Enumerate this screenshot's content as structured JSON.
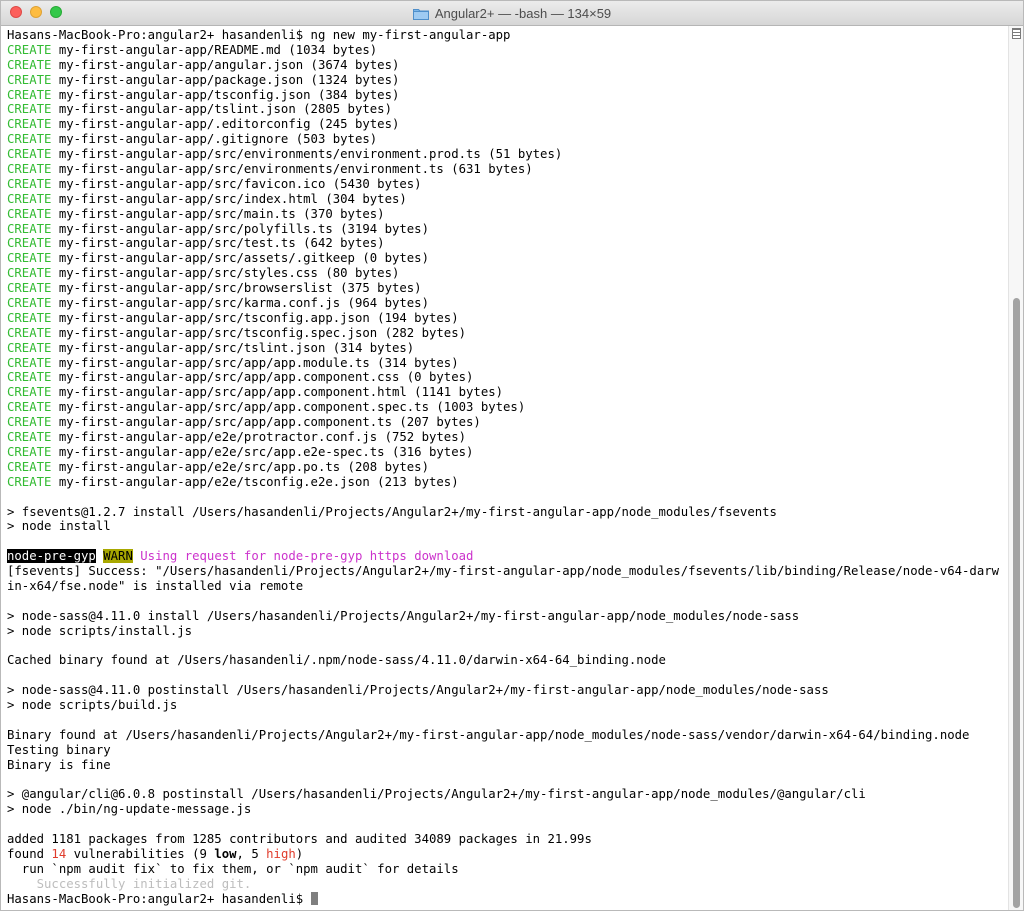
{
  "window": {
    "title": "Angular2+ — -bash — 134×59"
  },
  "icons": {
    "title": "folder-icon",
    "close": "close-button",
    "minimize": "minimize-button",
    "maximize": "zoom-button",
    "split": "split-pane-icon"
  },
  "colors": {
    "create": "#33bb33",
    "warn_message": "#cc33cc",
    "high_count": "#e03c2c"
  },
  "terminal": {
    "lines": [
      [
        {
          "t": "Hasans-MacBook-Pro:angular2+ hasandenli$ ng new my-first-angular-app"
        }
      ],
      [
        {
          "t": "CREATE",
          "c": "green"
        },
        {
          "t": " my-first-angular-app/README.md (1034 bytes)"
        }
      ],
      [
        {
          "t": "CREATE",
          "c": "green"
        },
        {
          "t": " my-first-angular-app/angular.json (3674 bytes)"
        }
      ],
      [
        {
          "t": "CREATE",
          "c": "green"
        },
        {
          "t": " my-first-angular-app/package.json (1324 bytes)"
        }
      ],
      [
        {
          "t": "CREATE",
          "c": "green"
        },
        {
          "t": " my-first-angular-app/tsconfig.json (384 bytes)"
        }
      ],
      [
        {
          "t": "CREATE",
          "c": "green"
        },
        {
          "t": " my-first-angular-app/tslint.json (2805 bytes)"
        }
      ],
      [
        {
          "t": "CREATE",
          "c": "green"
        },
        {
          "t": " my-first-angular-app/.editorconfig (245 bytes)"
        }
      ],
      [
        {
          "t": "CREATE",
          "c": "green"
        },
        {
          "t": " my-first-angular-app/.gitignore (503 bytes)"
        }
      ],
      [
        {
          "t": "CREATE",
          "c": "green"
        },
        {
          "t": " my-first-angular-app/src/environments/environment.prod.ts (51 bytes)"
        }
      ],
      [
        {
          "t": "CREATE",
          "c": "green"
        },
        {
          "t": " my-first-angular-app/src/environments/environment.ts (631 bytes)"
        }
      ],
      [
        {
          "t": "CREATE",
          "c": "green"
        },
        {
          "t": " my-first-angular-app/src/favicon.ico (5430 bytes)"
        }
      ],
      [
        {
          "t": "CREATE",
          "c": "green"
        },
        {
          "t": " my-first-angular-app/src/index.html (304 bytes)"
        }
      ],
      [
        {
          "t": "CREATE",
          "c": "green"
        },
        {
          "t": " my-first-angular-app/src/main.ts (370 bytes)"
        }
      ],
      [
        {
          "t": "CREATE",
          "c": "green"
        },
        {
          "t": " my-first-angular-app/src/polyfills.ts (3194 bytes)"
        }
      ],
      [
        {
          "t": "CREATE",
          "c": "green"
        },
        {
          "t": " my-first-angular-app/src/test.ts (642 bytes)"
        }
      ],
      [
        {
          "t": "CREATE",
          "c": "green"
        },
        {
          "t": " my-first-angular-app/src/assets/.gitkeep (0 bytes)"
        }
      ],
      [
        {
          "t": "CREATE",
          "c": "green"
        },
        {
          "t": " my-first-angular-app/src/styles.css (80 bytes)"
        }
      ],
      [
        {
          "t": "CREATE",
          "c": "green"
        },
        {
          "t": " my-first-angular-app/src/browserslist (375 bytes)"
        }
      ],
      [
        {
          "t": "CREATE",
          "c": "green"
        },
        {
          "t": " my-first-angular-app/src/karma.conf.js (964 bytes)"
        }
      ],
      [
        {
          "t": "CREATE",
          "c": "green"
        },
        {
          "t": " my-first-angular-app/src/tsconfig.app.json (194 bytes)"
        }
      ],
      [
        {
          "t": "CREATE",
          "c": "green"
        },
        {
          "t": " my-first-angular-app/src/tsconfig.spec.json (282 bytes)"
        }
      ],
      [
        {
          "t": "CREATE",
          "c": "green"
        },
        {
          "t": " my-first-angular-app/src/tslint.json (314 bytes)"
        }
      ],
      [
        {
          "t": "CREATE",
          "c": "green"
        },
        {
          "t": " my-first-angular-app/src/app/app.module.ts (314 bytes)"
        }
      ],
      [
        {
          "t": "CREATE",
          "c": "green"
        },
        {
          "t": " my-first-angular-app/src/app/app.component.css (0 bytes)"
        }
      ],
      [
        {
          "t": "CREATE",
          "c": "green"
        },
        {
          "t": " my-first-angular-app/src/app/app.component.html (1141 bytes)"
        }
      ],
      [
        {
          "t": "CREATE",
          "c": "green"
        },
        {
          "t": " my-first-angular-app/src/app/app.component.spec.ts (1003 bytes)"
        }
      ],
      [
        {
          "t": "CREATE",
          "c": "green"
        },
        {
          "t": " my-first-angular-app/src/app/app.component.ts (207 bytes)"
        }
      ],
      [
        {
          "t": "CREATE",
          "c": "green"
        },
        {
          "t": " my-first-angular-app/e2e/protractor.conf.js (752 bytes)"
        }
      ],
      [
        {
          "t": "CREATE",
          "c": "green"
        },
        {
          "t": " my-first-angular-app/e2e/src/app.e2e-spec.ts (316 bytes)"
        }
      ],
      [
        {
          "t": "CREATE",
          "c": "green"
        },
        {
          "t": " my-first-angular-app/e2e/src/app.po.ts (208 bytes)"
        }
      ],
      [
        {
          "t": "CREATE",
          "c": "green"
        },
        {
          "t": " my-first-angular-app/e2e/tsconfig.e2e.json (213 bytes)"
        }
      ],
      [],
      [
        {
          "t": "> fsevents@1.2.7 install /Users/hasandenli/Projects/Angular2+/my-first-angular-app/node_modules/fsevents"
        }
      ],
      [
        {
          "t": "> node install"
        }
      ],
      [],
      [
        {
          "t": "node-pre-gyp",
          "c": "inv-black"
        },
        {
          "t": " "
        },
        {
          "t": "WARN",
          "c": "inv-yellow"
        },
        {
          "t": " "
        },
        {
          "t": "Using request for node-pre-gyp https download",
          "c": "magenta"
        }
      ],
      [
        {
          "t": "[fsevents] Success: \"/Users/hasandenli/Projects/Angular2+/my-first-angular-app/node_modules/fsevents/lib/binding/Release/node-v64-darw"
        }
      ],
      [
        {
          "t": "in-x64/fse.node\" is installed via remote"
        }
      ],
      [],
      [
        {
          "t": "> node-sass@4.11.0 install /Users/hasandenli/Projects/Angular2+/my-first-angular-app/node_modules/node-sass"
        }
      ],
      [
        {
          "t": "> node scripts/install.js"
        }
      ],
      [],
      [
        {
          "t": "Cached binary found at /Users/hasandenli/.npm/node-sass/4.11.0/darwin-x64-64_binding.node"
        }
      ],
      [],
      [
        {
          "t": "> node-sass@4.11.0 postinstall /Users/hasandenli/Projects/Angular2+/my-first-angular-app/node_modules/node-sass"
        }
      ],
      [
        {
          "t": "> node scripts/build.js"
        }
      ],
      [],
      [
        {
          "t": "Binary found at /Users/hasandenli/Projects/Angular2+/my-first-angular-app/node_modules/node-sass/vendor/darwin-x64-64/binding.node"
        }
      ],
      [
        {
          "t": "Testing binary"
        }
      ],
      [
        {
          "t": "Binary is fine"
        }
      ],
      [],
      [
        {
          "t": "> @angular/cli@6.0.8 postinstall /Users/hasandenli/Projects/Angular2+/my-first-angular-app/node_modules/@angular/cli"
        }
      ],
      [
        {
          "t": "> node ./bin/ng-update-message.js"
        }
      ],
      [],
      [
        {
          "t": "added 1181 packages from 1285 contributors and audited 34089 packages in 21.99s"
        }
      ],
      [
        {
          "t": "found "
        },
        {
          "t": "14",
          "c": "red"
        },
        {
          "t": " vulnerabilities (9 "
        },
        {
          "t": "low",
          "c": "bold"
        },
        {
          "t": ", 5 "
        },
        {
          "t": "high",
          "c": "red"
        },
        {
          "t": ")"
        }
      ],
      [
        {
          "t": "  run `npm audit fix` to fix them, or `npm audit` for details"
        }
      ],
      [
        {
          "t": "    Successfully initialized git.",
          "c": "dim"
        }
      ],
      [
        {
          "t": "Hasans-MacBook-Pro:angular2+ hasandenli$ "
        },
        {
          "cursor": true
        }
      ]
    ]
  }
}
